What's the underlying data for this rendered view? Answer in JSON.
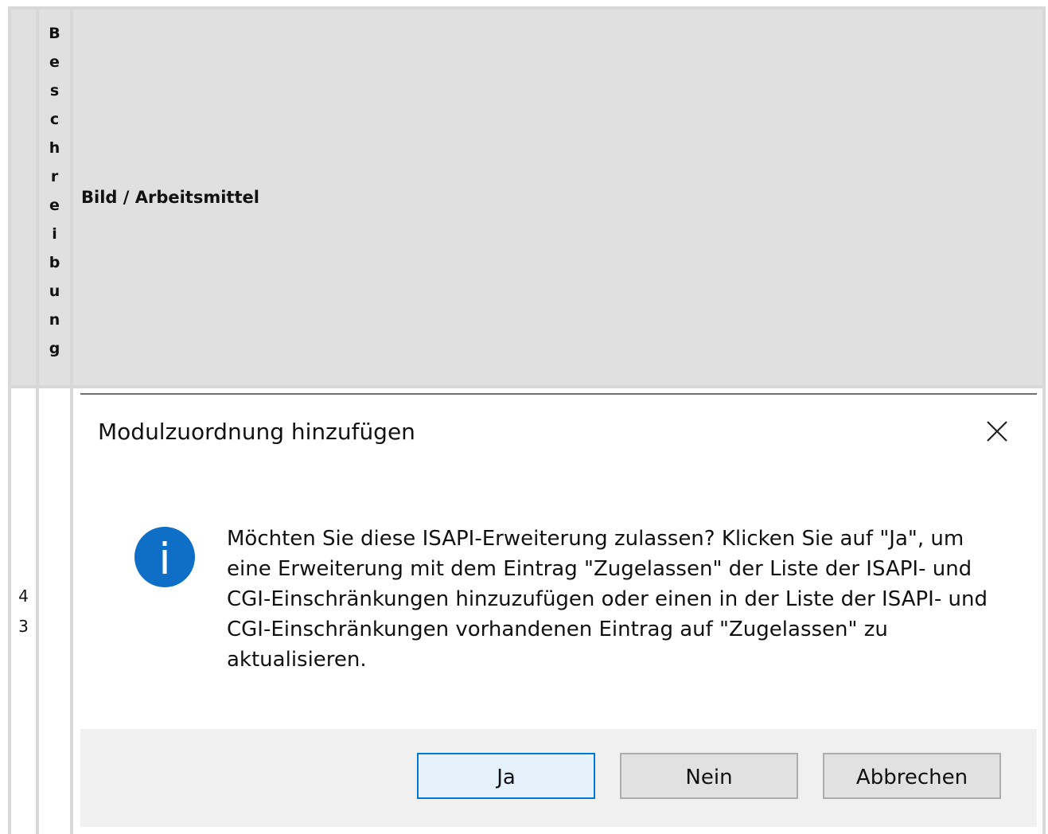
{
  "table": {
    "header_number": "",
    "header_description": [
      "B",
      "e",
      "s",
      "c",
      "h",
      "r",
      "e",
      "i",
      "b",
      "u",
      "n",
      "g"
    ],
    "header_image": "Bild / Arbeitsmittel",
    "row_number": [
      "4",
      "3"
    ]
  },
  "dialog": {
    "title": "Modulzuordnung hinzufügen",
    "message": "Möchten Sie diese ISAPI-Erweiterung zulassen? Klicken Sie auf \"Ja\", um eine Erweiterung mit dem Eintrag \"Zugelassen\" der Liste der ISAPI- und CGI-Einschränkungen hinzuzufügen oder einen in der Liste der ISAPI- und CGI-Einschränkungen vorhandenen Eintrag auf \"Zugelassen\" zu aktualisieren.",
    "buttons": {
      "yes": "Ja",
      "no": "Nein",
      "cancel": "Abbrechen"
    },
    "icons": {
      "info": "info-icon",
      "close": "close-icon"
    },
    "accent_color": "#0078d7"
  }
}
